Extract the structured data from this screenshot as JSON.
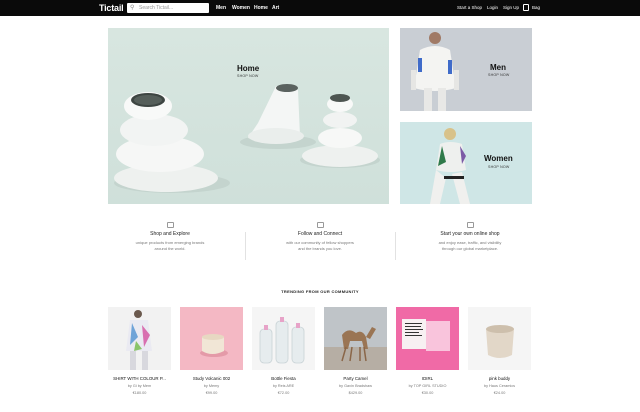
{
  "header": {
    "logo": "Tictail",
    "search_placeholder": "Search Tictail...",
    "nav": [
      "Men",
      "Women",
      "Home",
      "Art"
    ],
    "right_links": [
      "Start a Shop",
      "Login",
      "Sign Up"
    ],
    "bag_label": "Bag"
  },
  "hero": {
    "title": "Home",
    "cta": "SHOP NOW"
  },
  "tiles": [
    {
      "title": "Men",
      "cta": "SHOP NOW"
    },
    {
      "title": "Women",
      "cta": "SHOP NOW"
    }
  ],
  "features": [
    {
      "title": "Shop and Explore",
      "desc1": "unique products from emerging brands",
      "desc2": "around the world."
    },
    {
      "title": "Follow and Connect",
      "desc1": "with our community of fellow shoppers",
      "desc2": "and the brands you love."
    },
    {
      "title": "Start your own online shop",
      "desc1": "and enjoy ease, traffic, and visibility",
      "desc2": "through our global marketplace."
    }
  ],
  "trending_title": "TRENDING FROM OUR COMMUNITY",
  "products": [
    {
      "name": "SHIRT WITH COLOUR P...",
      "by": "by Gi by Mem",
      "price": "€180.00"
    },
    {
      "name": "Study Volcanic 002",
      "by": "by Memy",
      "price": "€99.00"
    },
    {
      "name": "Bottle Fiesta",
      "by": "by Reis ARE",
      "price": "€72.00"
    },
    {
      "name": "Party Camel",
      "by": "by Gavin Bradshaw",
      "price": "$429.00"
    },
    {
      "name": "IDIRL",
      "by": "by TOP GIRL STUDIO",
      "price": "€30.00"
    },
    {
      "name": "pink buddy",
      "by": "by Haus Ceramics",
      "price": "€24.00"
    }
  ],
  "colors": {
    "topbar": "#0a0a0a",
    "hero_bg": "#d8e6e0",
    "men_bg": "#c9ced4",
    "women_bg": "#cfe6e6"
  }
}
